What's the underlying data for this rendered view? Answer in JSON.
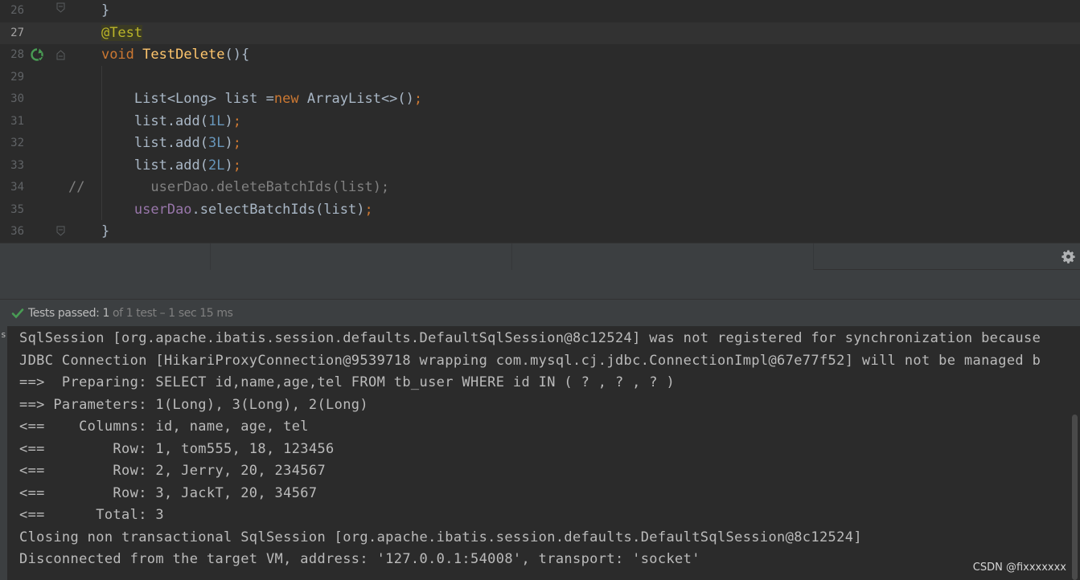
{
  "editor": {
    "lines": [
      {
        "num": "26",
        "tokens": [
          {
            "t": "    }",
            "c": ""
          }
        ]
      },
      {
        "num": "27",
        "current": true,
        "tokens": [
          {
            "t": "    ",
            "c": ""
          },
          {
            "t": "@Test",
            "c": "ann"
          }
        ]
      },
      {
        "num": "28",
        "tokens": [
          {
            "t": "    ",
            "c": ""
          },
          {
            "t": "void ",
            "c": "kw"
          },
          {
            "t": "TestDelete",
            "c": "fn"
          },
          {
            "t": "(){",
            "c": ""
          }
        ]
      },
      {
        "num": "29",
        "tokens": []
      },
      {
        "num": "30",
        "tokens": [
          {
            "t": "        List<Long> list =",
            "c": ""
          },
          {
            "t": "new ",
            "c": "kw"
          },
          {
            "t": "ArrayList<>()",
            "c": ""
          },
          {
            "t": ";",
            "c": "semi"
          }
        ]
      },
      {
        "num": "31",
        "tokens": [
          {
            "t": "        list.add(",
            "c": ""
          },
          {
            "t": "1L",
            "c": "num"
          },
          {
            "t": ")",
            "c": ""
          },
          {
            "t": ";",
            "c": "semi"
          }
        ]
      },
      {
        "num": "32",
        "tokens": [
          {
            "t": "        list.add(",
            "c": ""
          },
          {
            "t": "3L",
            "c": "num"
          },
          {
            "t": ")",
            "c": ""
          },
          {
            "t": ";",
            "c": "semi"
          }
        ]
      },
      {
        "num": "33",
        "tokens": [
          {
            "t": "        list.add(",
            "c": ""
          },
          {
            "t": "2L",
            "c": "num"
          },
          {
            "t": ")",
            "c": ""
          },
          {
            "t": ";",
            "c": "semi"
          }
        ]
      },
      {
        "num": "34",
        "tokens": [
          {
            "t": "//        userDao.deleteBatchIds(list);",
            "c": "cmt"
          }
        ]
      },
      {
        "num": "35",
        "tokens": [
          {
            "t": "        ",
            "c": ""
          },
          {
            "t": "userDao",
            "c": "fld"
          },
          {
            "t": ".selectBatchIds(list)",
            "c": ""
          },
          {
            "t": ";",
            "c": "semi"
          }
        ]
      },
      {
        "num": "36",
        "tokens": [
          {
            "t": "    }",
            "c": ""
          }
        ]
      }
    ]
  },
  "test_status": {
    "label": "Tests passed: ",
    "count": "1",
    "detail": " of 1 test – 1 sec 15 ms",
    "icon": "check-icon"
  },
  "console": {
    "edge_glyph": "s",
    "lines": [
      "SqlSession [org.apache.ibatis.session.defaults.DefaultSqlSession@8c12524] was not registered for synchronization because",
      "JDBC Connection [HikariProxyConnection@9539718 wrapping com.mysql.cj.jdbc.ConnectionImpl@67e77f52] will not be managed b",
      "==>  Preparing: SELECT id,name,age,tel FROM tb_user WHERE id IN ( ? , ? , ? )",
      "==> Parameters: 1(Long), 3(Long), 2(Long)",
      "<==    Columns: id, name, age, tel",
      "<==        Row: 1, tom555, 18, 123456",
      "<==        Row: 2, Jerry, 20, 234567",
      "<==        Row: 3, JackT, 20, 34567",
      "<==      Total: 3",
      "Closing non transactional SqlSession [org.apache.ibatis.session.defaults.DefaultSqlSession@8c12524]",
      "Disconnected from the target VM, address: '127.0.0.1:54008', transport: 'socket'"
    ]
  },
  "watermark": "CSDN @fixxxxxxx",
  "colors": {
    "editor_bg": "#2b2b2b",
    "panel_bg": "#3c3f41",
    "keyword": "#cc7832",
    "function": "#ffc66d",
    "number": "#6897bb",
    "field": "#9876aa",
    "comment": "#808080",
    "annotation": "#bbb529",
    "success": "#499c54"
  }
}
